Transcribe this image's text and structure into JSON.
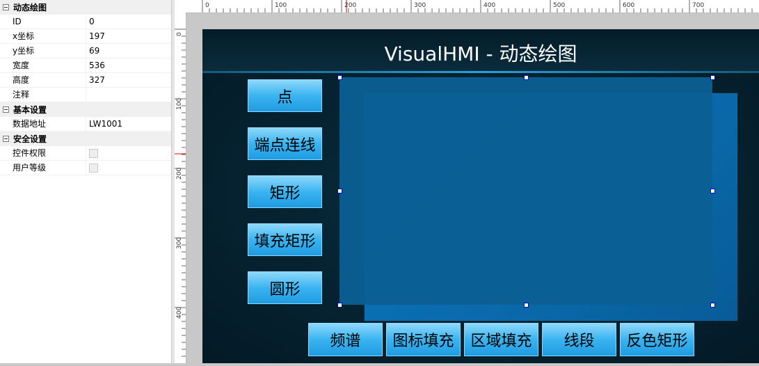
{
  "properties": {
    "categories": [
      {
        "title": "动态绘图",
        "rows": [
          {
            "key": "ID",
            "value": "0"
          },
          {
            "key": "x坐标",
            "value": "197"
          },
          {
            "key": "y坐标",
            "value": "69"
          },
          {
            "key": "宽度",
            "value": "536"
          },
          {
            "key": "高度",
            "value": "327"
          },
          {
            "key": "注释",
            "value": ""
          }
        ]
      },
      {
        "title": "基本设置",
        "rows": [
          {
            "key": "数据地址",
            "value": "LW1001"
          }
        ]
      },
      {
        "title": "安全设置",
        "rows": [
          {
            "key": "控件权限",
            "value": ""
          },
          {
            "key": "用户等级",
            "value": ""
          }
        ]
      }
    ]
  },
  "ruler": {
    "h_labels": [
      "0",
      "100",
      "200",
      "300",
      "400",
      "500",
      "600",
      "700"
    ],
    "v_labels": [
      "0",
      "100",
      "200",
      "300",
      "400"
    ]
  },
  "screen": {
    "title": "VisualHMI - 动态绘图",
    "left_buttons": [
      "点",
      "端点连线",
      "矩形",
      "填充矩形",
      "圆形"
    ],
    "bottom_buttons": [
      "频谱",
      "图标填充",
      "区域填充",
      "线段",
      "反色矩形"
    ]
  },
  "colors": {
    "accent": "#2aa0d8",
    "button": "#3ab4f0",
    "selection_handle": "#0000ff"
  }
}
